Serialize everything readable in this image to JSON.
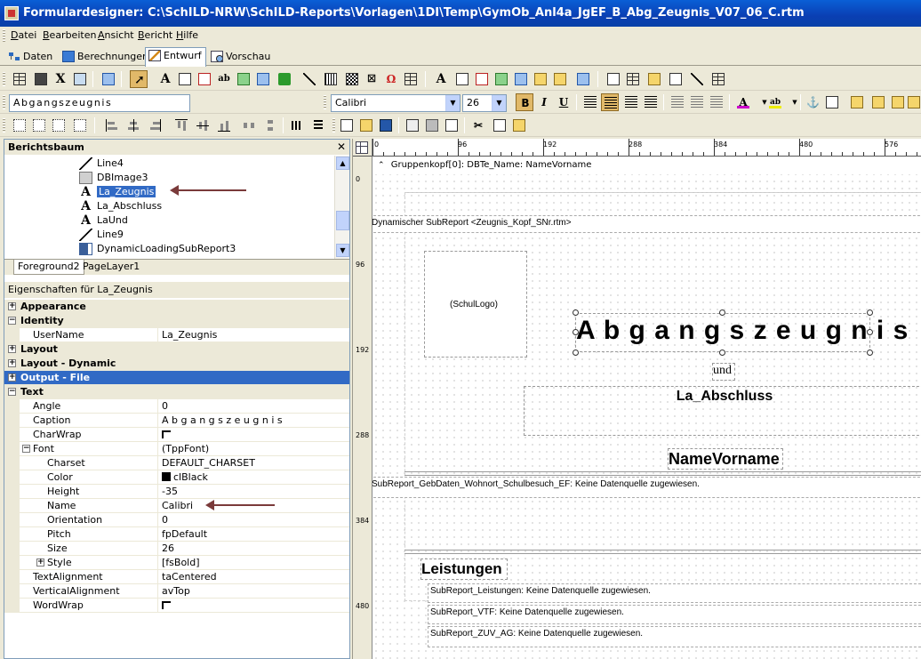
{
  "window": {
    "title": "Formulardesigner: C:\\SchILD-NRW\\SchILD-Reports\\Vorlagen\\1DI\\Temp\\GymOb_Anl4a_JgEF_B_Abg_Zeugnis_V07_06_C.rtm"
  },
  "menu": [
    "Datei",
    "Bearbeiten",
    "Ansicht",
    "Bericht",
    "Hilfe"
  ],
  "tabs": [
    "Daten",
    "Berechnungen",
    "Entwurf",
    "Vorschau"
  ],
  "active_tab": "Entwurf",
  "format_toolbar": {
    "text_value": "Abgangszeugnis",
    "font": "Calibri",
    "size": "26"
  },
  "tree": {
    "header": "Berichtsbaum",
    "close_glyph": "✕",
    "items": [
      {
        "label": "Line4",
        "icon": "line-icon"
      },
      {
        "label": "DBImage3",
        "icon": "image-icon"
      },
      {
        "label": "La_Zeugnis",
        "icon": "label-icon",
        "selected": true
      },
      {
        "label": "La_Abschluss",
        "icon": "label-icon"
      },
      {
        "label": "LaUnd",
        "icon": "label-icon"
      },
      {
        "label": "Line9",
        "icon": "line-icon"
      },
      {
        "label": "DynamicLoadingSubReport3",
        "icon": "subreport-icon"
      }
    ],
    "layer_tabs": [
      "Foreground2",
      "PageLayer1"
    ]
  },
  "properties": {
    "title": "Eigenschaften für La_Zeugnis",
    "rows": [
      {
        "type": "cat",
        "name": "Appearance",
        "expanded": false
      },
      {
        "type": "cat",
        "name": "Identity",
        "expanded": true
      },
      {
        "type": "prop",
        "name": "UserName",
        "value": "La_Zeugnis",
        "level": 1
      },
      {
        "type": "cat",
        "name": "Layout",
        "expanded": false
      },
      {
        "type": "cat",
        "name": "Layout - Dynamic",
        "expanded": false
      },
      {
        "type": "cat",
        "name": "Output - File",
        "expanded": false,
        "selected": true
      },
      {
        "type": "cat",
        "name": "Text",
        "expanded": true
      },
      {
        "type": "prop",
        "name": "Angle",
        "value": "0",
        "level": 1
      },
      {
        "type": "prop",
        "name": "Caption",
        "value": "A b g a n g s z e u g n i s",
        "level": 1
      },
      {
        "type": "prop",
        "name": "CharWrap",
        "value": "",
        "check": true,
        "level": 1
      },
      {
        "type": "prop",
        "name": "Font",
        "value": "(TppFont)",
        "level": 1,
        "expander": "-"
      },
      {
        "type": "prop",
        "name": "Charset",
        "value": "DEFAULT_CHARSET",
        "level": 2
      },
      {
        "type": "prop",
        "name": "Color",
        "value": "clBlack",
        "swatch": "#000000",
        "level": 2
      },
      {
        "type": "prop",
        "name": "Height",
        "value": "-35",
        "level": 2
      },
      {
        "type": "prop",
        "name": "Name",
        "value": "Calibri",
        "level": 2
      },
      {
        "type": "prop",
        "name": "Orientation",
        "value": "0",
        "level": 2
      },
      {
        "type": "prop",
        "name": "Pitch",
        "value": "fpDefault",
        "level": 2
      },
      {
        "type": "prop",
        "name": "Size",
        "value": "26",
        "level": 2
      },
      {
        "type": "prop",
        "name": "Style",
        "value": "[fsBold]",
        "level": 2,
        "expander": "+"
      },
      {
        "type": "prop",
        "name": "TextAlignment",
        "value": "taCentered",
        "level": 1
      },
      {
        "type": "prop",
        "name": "VerticalAlignment",
        "value": "avTop",
        "level": 1
      },
      {
        "type": "prop",
        "name": "WordWrap",
        "value": "",
        "check": true,
        "level": 1
      }
    ]
  },
  "ruler": {
    "h_labels": [
      "0",
      "96",
      "192",
      "288",
      "384",
      "480",
      "576"
    ],
    "v_labels": [
      "0",
      "96",
      "192",
      "288",
      "384",
      "480"
    ]
  },
  "design": {
    "band_header": "Gruppenkopf[0]: DBTe_Name: NameVorname",
    "subreport_kopf": "Dynamischer SubReport <Zeugnis_Kopf_SNr.rtm>",
    "schullogo": "(SchulLogo)",
    "title": "A b g a n g s z e u g n i s",
    "und": "und",
    "abschluss": "La_Abschluss",
    "name": "NameVorname",
    "gebdaten": "SubReport_GebDaten_Wohnort_Schulbesuch_EF: Keine Datenquelle zugewiesen.",
    "leistungen": "Leistungen",
    "sub_leistungen": "SubReport_Leistungen: Keine Datenquelle zugewiesen.",
    "sub_vtf": "SubReport_VTF: Keine Datenquelle zugewiesen.",
    "sub_zuv": "SubReport_ZUV_AG: Keine Datenquelle zugewiesen."
  },
  "colors": {
    "titlebar": "#0a4fc4",
    "selection": "#316ac5",
    "annotation_arrow": "#7a3a3a"
  }
}
